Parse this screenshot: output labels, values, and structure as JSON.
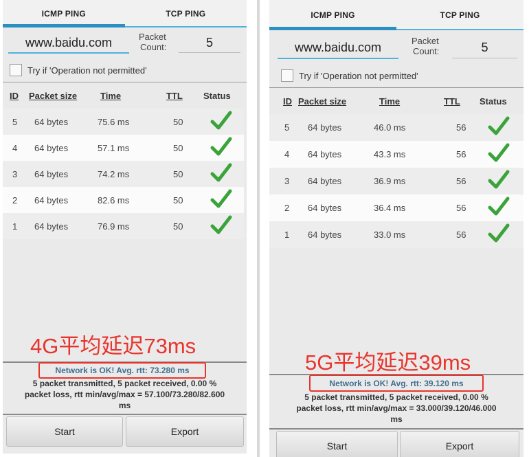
{
  "tabs": [
    "ICMP PING",
    "TCP PING"
  ],
  "host": "www.baidu.com",
  "packet_count_label": [
    "Packet",
    "Count:"
  ],
  "packet_count": "5",
  "checkbox_label": "Try if 'Operation not permitted'",
  "table_headers": [
    "ID",
    "Packet size",
    "Time",
    "TTL",
    "Status"
  ],
  "panels": [
    {
      "rows": [
        {
          "id": "5",
          "size": "64 bytes",
          "time": "75.6 ms",
          "ttl": "50"
        },
        {
          "id": "4",
          "size": "64 bytes",
          "time": "57.1 ms",
          "ttl": "50"
        },
        {
          "id": "3",
          "size": "64 bytes",
          "time": "74.2 ms",
          "ttl": "50"
        },
        {
          "id": "2",
          "size": "64 bytes",
          "time": "82.6 ms",
          "ttl": "50"
        },
        {
          "id": "1",
          "size": "64 bytes",
          "time": "76.9 ms",
          "ttl": "50"
        }
      ],
      "overlay": "4G平均延迟73ms",
      "status": "Network is OK! Avg. rtt: 73.280 ms",
      "summary": [
        "5 packet transmitted, 5 packet received, 0.00 %",
        "packet loss, rtt min/avg/max = 57.100/73.280/82.600",
        "ms"
      ]
    },
    {
      "rows": [
        {
          "id": "5",
          "size": "64 bytes",
          "time": "46.0 ms",
          "ttl": "56"
        },
        {
          "id": "4",
          "size": "64 bytes",
          "time": "43.3 ms",
          "ttl": "56"
        },
        {
          "id": "3",
          "size": "64 bytes",
          "time": "36.9 ms",
          "ttl": "56"
        },
        {
          "id": "2",
          "size": "64 bytes",
          "time": "36.4 ms",
          "ttl": "56"
        },
        {
          "id": "1",
          "size": "64 bytes",
          "time": "33.0 ms",
          "ttl": "56"
        }
      ],
      "overlay": "5G平均延迟39ms",
      "status": "Network is OK! Avg. rtt: 39.120 ms",
      "summary": [
        "5 packet transmitted, 5 packet received, 0.00 %",
        "packet loss, rtt min/avg/max = 33.000/39.120/46.000",
        "ms"
      ]
    }
  ],
  "buttons": {
    "start": "Start",
    "export": "Export"
  },
  "colors": {
    "accent": "#2a8fc1",
    "underline": "#4fb3d9",
    "check": "#3aa33a",
    "annotation": "#e8342c",
    "status_text": "#3f6f8f"
  },
  "icons": {
    "status": "check-icon"
  }
}
